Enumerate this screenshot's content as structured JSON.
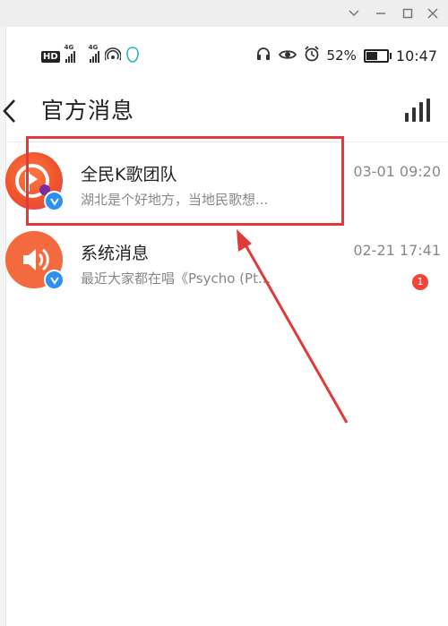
{
  "window": {
    "controls": [
      "chevron-down-icon",
      "minimize-icon",
      "maximize-icon",
      "close-icon"
    ]
  },
  "status_bar": {
    "hd_label": "HD",
    "network_1": "4G",
    "network_2": "4G",
    "battery_percent": "52%",
    "battery_level": 0.52,
    "time": "10:47",
    "icons": [
      "headset-icon",
      "eye-icon",
      "alarm-icon",
      "battery-icon",
      "wifi-hotspot-icon",
      "app-notification-icon"
    ]
  },
  "header": {
    "title": "官方消息"
  },
  "messages": [
    {
      "name": "全民K歌团队",
      "preview": "湖北是个好地方，当地民歌想...",
      "time": "03-01 09:20",
      "verified": true,
      "avatar_icon": "kge-logo-icon",
      "avatar_color": "#f0542c"
    },
    {
      "name": "系统消息",
      "preview": "最近大家都在唱《Psycho (Pt...",
      "time": "02-21 17:41",
      "verified": true,
      "unread": "1",
      "avatar_icon": "speaker-icon",
      "avatar_color": "#f26a3d"
    }
  ],
  "colors": {
    "highlight": "#e03a3a",
    "verified": "#2d8ff0",
    "badge": "#f0443c"
  }
}
